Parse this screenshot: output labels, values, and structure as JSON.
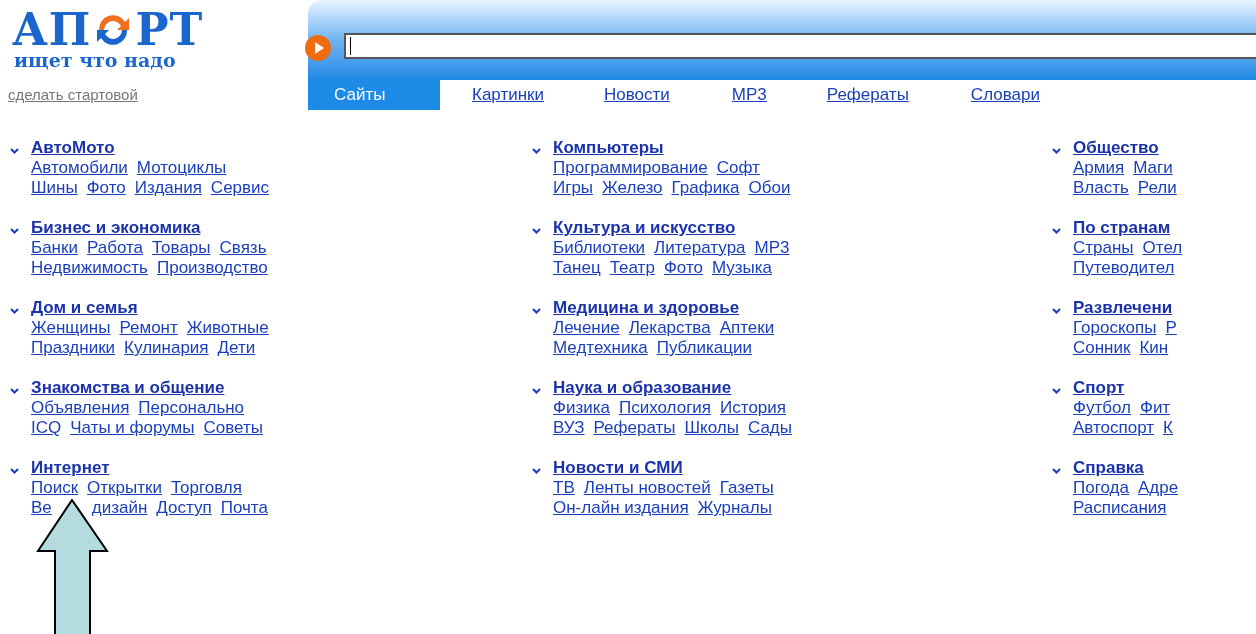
{
  "logo": {
    "left": "АП",
    "right": "РТ",
    "slogan": "ищет что надо"
  },
  "make_start_link": "сделать стартовой",
  "tabs": [
    {
      "label": "Сайты",
      "selected": true
    },
    {
      "label": "Картинки",
      "selected": false
    },
    {
      "label": "Новости",
      "selected": false
    },
    {
      "label": "MP3",
      "selected": false
    },
    {
      "label": "Рефераты",
      "selected": false
    },
    {
      "label": "Словари",
      "selected": false
    }
  ],
  "columns": [
    {
      "categories": [
        {
          "title": "АвтоМото",
          "lines": [
            [
              "Автомобили",
              "Мотоциклы"
            ],
            [
              "Шины",
              "Фото",
              "Издания",
              "Сервис"
            ]
          ]
        },
        {
          "title": "Бизнес и экономика",
          "lines": [
            [
              "Банки",
              "Работа",
              "Товары",
              "Связь"
            ],
            [
              "Недвижимость",
              "Производство"
            ]
          ]
        },
        {
          "title": "Дом и семья",
          "lines": [
            [
              "Женщины",
              "Ремонт",
              "Животные"
            ],
            [
              "Праздники",
              "Кулинария",
              "Дети"
            ]
          ]
        },
        {
          "title": "Знакомства и общение",
          "lines": [
            [
              "Объявления",
              "Персонально"
            ],
            [
              "ICQ",
              "Чаты и форумы",
              "Советы"
            ]
          ]
        },
        {
          "title": "Интернет",
          "lines": [
            [
              "Поиск",
              "Открытки",
              "Торговля"
            ],
            [
              "Ве",
              {
                "kind": "arrow"
              },
              "дизайн",
              "Доступ",
              "Почта"
            ]
          ]
        }
      ]
    },
    {
      "categories": [
        {
          "title": "Компьютеры",
          "lines": [
            [
              "Программирование",
              "Софт"
            ],
            [
              "Игры",
              "Железо",
              "Графика",
              "Обои"
            ]
          ]
        },
        {
          "title": "Культура и искусство",
          "lines": [
            [
              "Библиотеки",
              "Литература",
              "MP3"
            ],
            [
              "Танец",
              "Театр",
              "Фото",
              "Музыка"
            ]
          ]
        },
        {
          "title": "Медицина и здоровье",
          "lines": [
            [
              "Лечение",
              "Лекарства",
              "Аптеки"
            ],
            [
              "Медтехника",
              "Публикации"
            ]
          ]
        },
        {
          "title": "Наука и образование",
          "lines": [
            [
              "Физика",
              "Психология",
              "История"
            ],
            [
              "ВУЗ",
              "Рефераты",
              "Школы",
              "Сады"
            ]
          ]
        },
        {
          "title": "Новости и СМИ",
          "lines": [
            [
              "ТВ",
              "Ленты новостей",
              "Газеты"
            ],
            [
              "Он-лайн издания",
              "Журналы"
            ]
          ]
        }
      ]
    },
    {
      "categories": [
        {
          "title": "Общество",
          "lines": [
            [
              "Армия",
              "Маги"
            ],
            [
              "Власть",
              "Рели"
            ]
          ]
        },
        {
          "title": "По странам",
          "lines": [
            [
              "Страны",
              "Отел"
            ],
            [
              "Путеводител"
            ]
          ]
        },
        {
          "title": "Развлечени",
          "lines": [
            [
              "Гороскопы",
              "Р"
            ],
            [
              "Сонник",
              "Кин"
            ]
          ]
        },
        {
          "title": "Спорт",
          "lines": [
            [
              "Футбол",
              "Фит"
            ],
            [
              "Автоспорт",
              "К"
            ]
          ]
        },
        {
          "title": "Справка",
          "lines": [
            [
              "Погода",
              "Адре"
            ],
            [
              "Расписания"
            ]
          ]
        }
      ]
    }
  ]
}
